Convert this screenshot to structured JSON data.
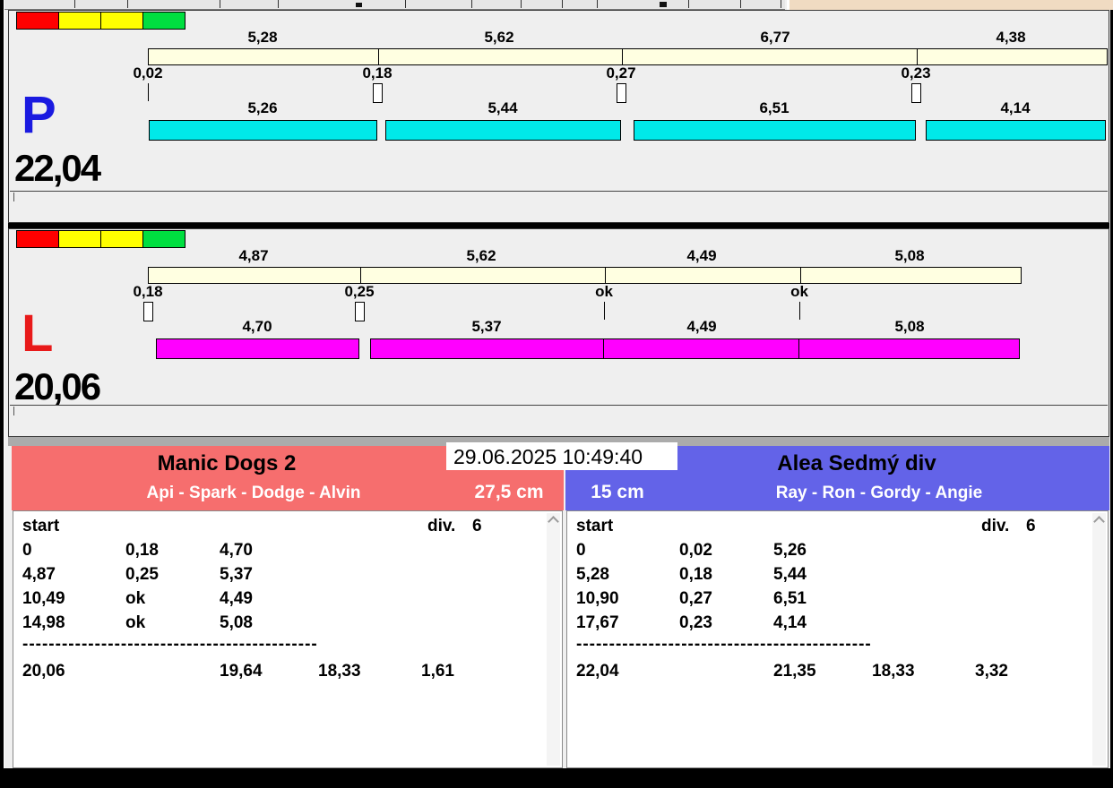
{
  "window": {
    "timestamp": "29.06.2025 10:49:40"
  },
  "colors": {
    "split_bar": "#FFFFE1",
    "lane_p_bar": "#00E9E9",
    "lane_l_bar": "#FF00FF",
    "team_left_header": "#F66E6E",
    "team_right_header": "#6363E8",
    "lane_p_letter": "#1A1AE0",
    "lane_l_letter": "#E81A1A",
    "traffic_light": [
      "red",
      "yellow",
      "yellow",
      "green"
    ]
  },
  "lanes": [
    {
      "letter": "P",
      "total": "22,04",
      "segments": [
        {
          "split": "5,28",
          "delay": "0,02",
          "dog": "5,26"
        },
        {
          "split": "5,62",
          "delay": "0,18",
          "dog": "5,44"
        },
        {
          "split": "6,77",
          "delay": "0,27",
          "dog": "6,51"
        },
        {
          "split": "4,38",
          "delay": "0,23",
          "dog": "4,14"
        }
      ]
    },
    {
      "letter": "L",
      "total": "20,06",
      "segments": [
        {
          "split": "4,87",
          "delay": "0,18",
          "dog": "4,70"
        },
        {
          "split": "5,62",
          "delay": "0,25",
          "dog": "5,37"
        },
        {
          "split": "4,49",
          "delay": "ok",
          "dog": "4,49"
        },
        {
          "split": "5,08",
          "delay": "ok",
          "dog": "5,08"
        }
      ]
    }
  ],
  "teams": [
    {
      "name": "Manic Dogs 2",
      "members": "Api - Spark - Dodge - Alvin",
      "height": "27,5 cm",
      "start_label": "start",
      "division_label": "div.",
      "division": "6",
      "runs": [
        [
          "0",
          "0,18",
          "4,70"
        ],
        [
          "4,87",
          "0,25",
          "5,37"
        ],
        [
          "10,49",
          "ok",
          "4,49"
        ],
        [
          "14,98",
          "ok",
          "5,08"
        ]
      ],
      "separator": "---------------------------------------------",
      "totals": [
        "20,06",
        "19,64",
        "18,33",
        "1,61"
      ]
    },
    {
      "name": "Alea Sedmý div",
      "members": "Ray - Ron - Gordy - Angie",
      "height": "15 cm",
      "start_label": "start",
      "division_label": "div.",
      "division": "6",
      "runs": [
        [
          "0",
          "0,02",
          "5,26"
        ],
        [
          "5,28",
          "0,18",
          "5,44"
        ],
        [
          "10,90",
          "0,27",
          "6,51"
        ],
        [
          "17,67",
          "0,23",
          "4,14"
        ]
      ],
      "separator": "---------------------------------------------",
      "totals": [
        "22,04",
        "21,35",
        "18,33",
        "3,32"
      ]
    }
  ]
}
